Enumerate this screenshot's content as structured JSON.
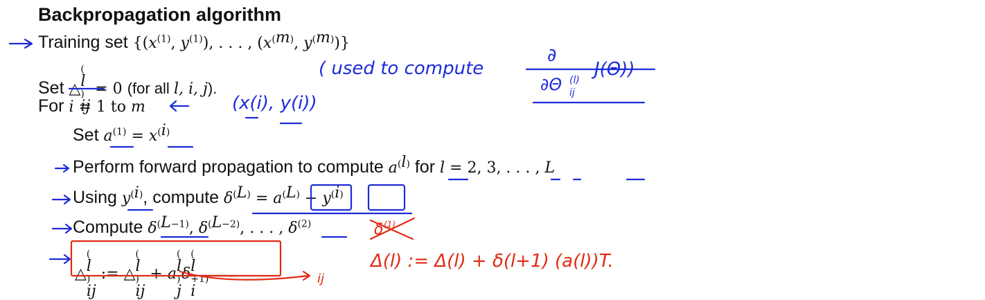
{
  "slide": {
    "title": "Backpropagation algorithm",
    "training_set_label": "Training set",
    "training_set_math": "{(x(1), y(1)), . . . , (x(m), y(m))}",
    "set_label": "Set",
    "set_condition": "(for all",
    "set_condition_vars": "l, i, j",
    "set_condition_end": ").",
    "for_label": "For",
    "for_range_word": "to",
    "inner_set_label": "Set",
    "forward_text": "Perform forward propagation to compute",
    "forward_for": "for",
    "using_label": "Using",
    "compute_label": ", compute",
    "compute_label2": "Compute"
  },
  "annotations": {
    "blue_note_text": "( used to compute",
    "blue_note_xy": "(x(i), y(i))",
    "red_note_rhs": "Δ(l) := Δ(l) + δ(l+1) (a(l))T.",
    "red_ij": "ij"
  },
  "colors": {
    "pen_blue": "#1d2bd8",
    "pen_red": "#e02a12"
  }
}
